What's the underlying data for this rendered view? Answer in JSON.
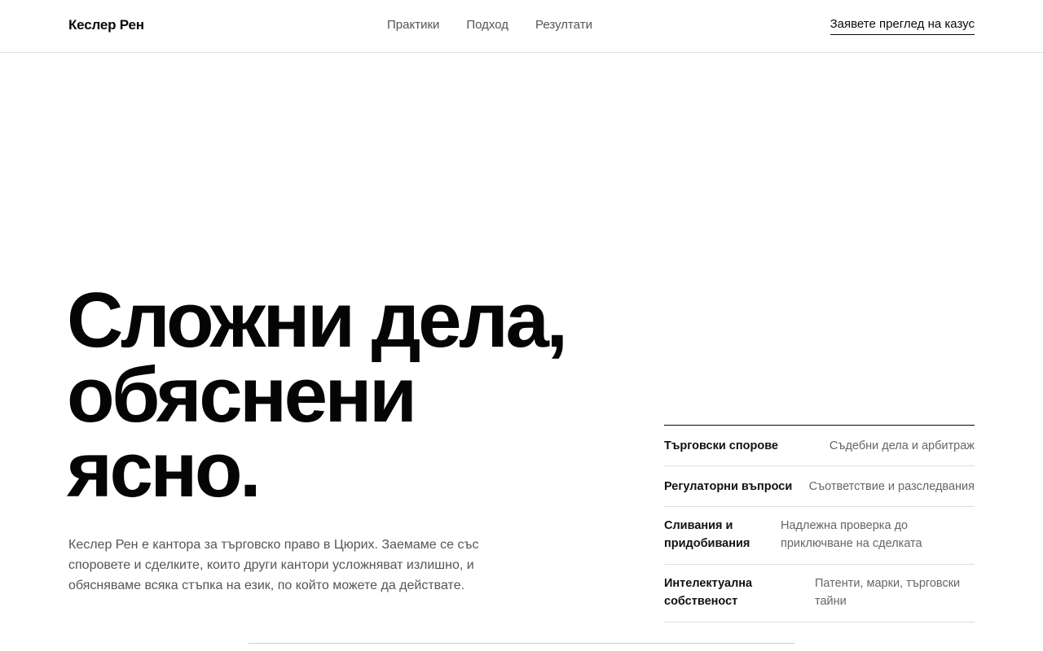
{
  "header": {
    "brand": "Кеслер Рен",
    "nav": [
      "Практики",
      "Подход",
      "Резултати"
    ],
    "cta": "Заявете преглед на казус"
  },
  "hero": {
    "title_lines": [
      "Сложни дела,",
      "обяснени",
      "ясно."
    ],
    "description": "Кеслер Рен е кантора за търговско право в Цюрих. Заемаме се със споровете и сделките, които други кантори усложняват излишно, и обясняваме всяка стъпка на език, по който можете да действате."
  },
  "practices": [
    {
      "name": "Търговски спорове",
      "desc": "Съдебни дела и арбитраж"
    },
    {
      "name": "Регулаторни въпроси",
      "desc": "Съответствие и разследвания"
    },
    {
      "name": "Сливания и придобивания",
      "desc": "Надлежна проверка до приключване на сделката"
    },
    {
      "name": "Интелектуална собственост",
      "desc": "Патенти, марки, търговски тайни"
    }
  ]
}
